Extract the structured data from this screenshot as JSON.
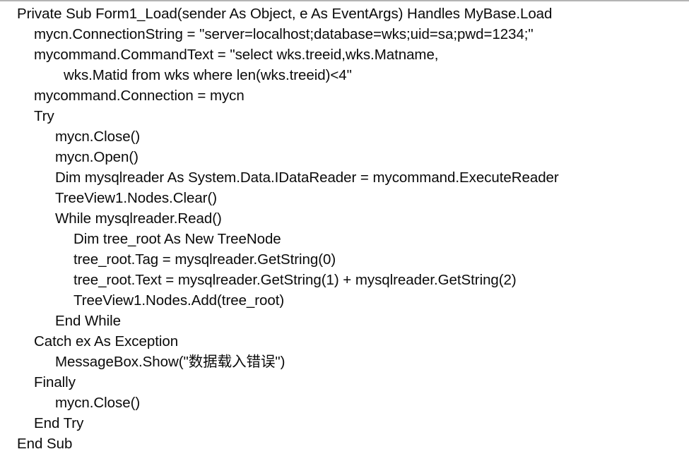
{
  "document": {
    "kind": "code-listing",
    "language": "VB.NET",
    "background_color": "#ffffff",
    "text_color": "#0a0a0a",
    "rule_color": "#b4b4b4",
    "line_count": 20
  },
  "code": {
    "lines": [
      {
        "indent": 0,
        "text": "Private Sub Form1_Load(sender As Object, e As EventArgs) Handles MyBase.Load"
      },
      {
        "indent": 1,
        "text": "mycn.ConnectionString = \"server=localhost;database=wks;uid=sa;pwd=1234;\""
      },
      {
        "indent": 1,
        "text": "mycommand.CommandText = \"select wks.treeid,wks.Matname,"
      },
      {
        "indent": 3,
        "text": "wks.Matid from wks where len(wks.treeid)<4\""
      },
      {
        "indent": 1,
        "text": "mycommand.Connection = mycn"
      },
      {
        "indent": 1,
        "text": "Try"
      },
      {
        "indent": 2,
        "text": "mycn.Close()"
      },
      {
        "indent": 2,
        "text": "mycn.Open()"
      },
      {
        "indent": 2,
        "text": "Dim mysqlreader As System.Data.IDataReader = mycommand.ExecuteReader"
      },
      {
        "indent": 2,
        "text": "TreeView1.Nodes.Clear()"
      },
      {
        "indent": 2,
        "text": "While mysqlreader.Read()"
      },
      {
        "indent": 4,
        "text": "Dim tree_root As New TreeNode"
      },
      {
        "indent": 4,
        "text": "tree_root.Tag = mysqlreader.GetString(0)"
      },
      {
        "indent": 4,
        "text": "tree_root.Text = mysqlreader.GetString(1) + mysqlreader.GetString(2)"
      },
      {
        "indent": 4,
        "text": "TreeView1.Nodes.Add(tree_root)"
      },
      {
        "indent": 2,
        "text": "End While"
      },
      {
        "indent": 1,
        "text": "Catch ex As Exception"
      },
      {
        "indent": 2,
        "text": "MessageBox.Show(\"数据载入错误\")"
      },
      {
        "indent": 1,
        "text": "Finally"
      },
      {
        "indent": 2,
        "text": "mycn.Close()"
      },
      {
        "indent": 1,
        "text": "End Try"
      },
      {
        "indent": 0,
        "text": "End Sub"
      }
    ]
  }
}
